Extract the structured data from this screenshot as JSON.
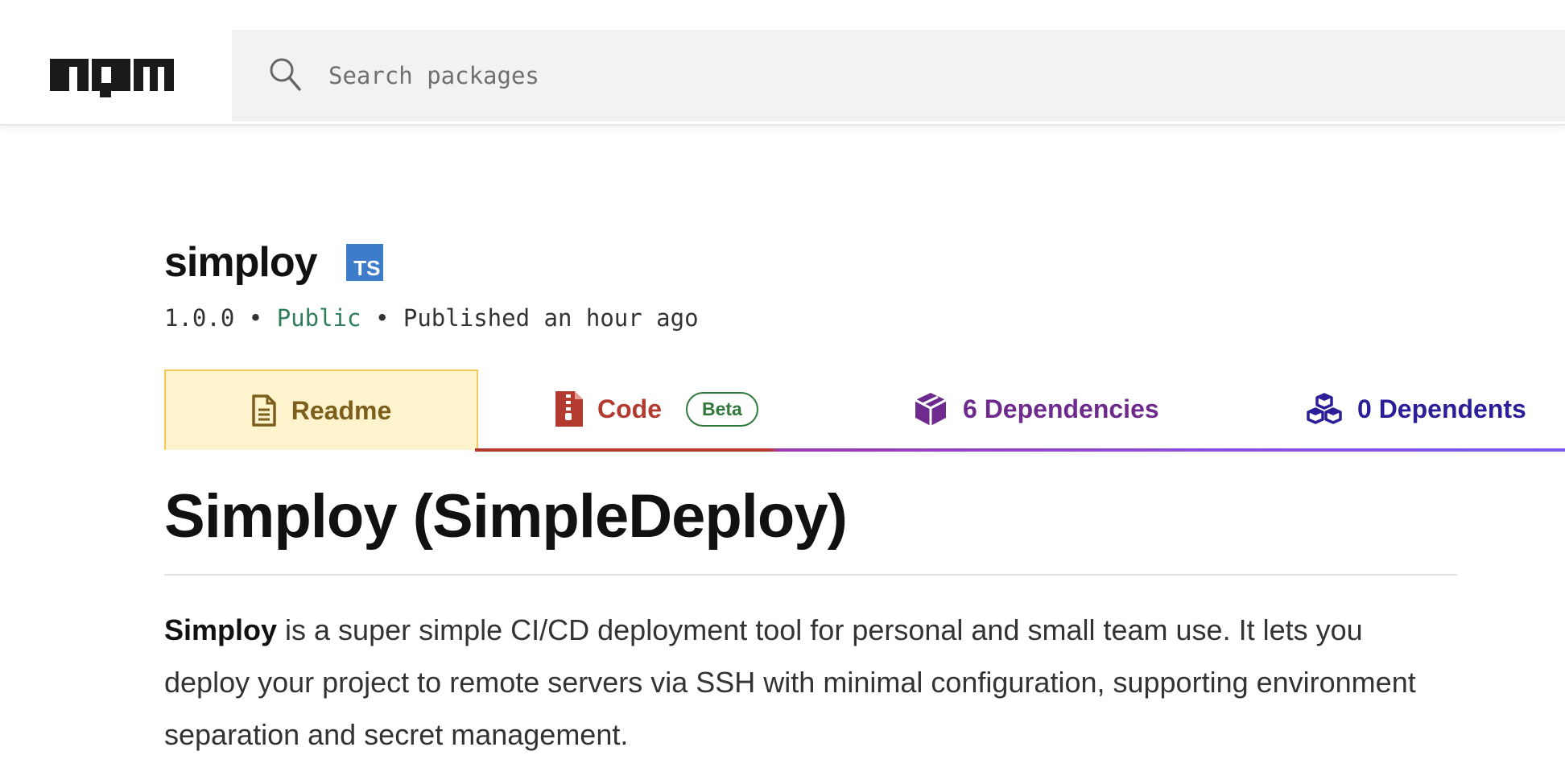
{
  "header": {
    "logo_text": "npm",
    "search_placeholder": "Search packages"
  },
  "package": {
    "name": "simploy",
    "ts_badge": "TS",
    "version": "1.0.0",
    "separator": "•",
    "visibility": "Public",
    "published": "Published an hour ago"
  },
  "tabs": {
    "readme": "Readme",
    "code": "Code",
    "code_badge": "Beta",
    "dependencies": "6 Dependencies",
    "dependents": "0 Dependents"
  },
  "readme": {
    "title": "Simploy (SimpleDeploy)",
    "intro_bold": "Simploy",
    "intro_rest": " is a super simple CI/CD deployment tool for personal and small team use. It lets you deploy your project to remote servers via SSH with minimal configuration, supporting environment separation and secret management."
  },
  "colors": {
    "readme_tab": "#7c5f1c",
    "code_tab": "#b23a2f",
    "dependencies_tab": "#6e2a8d",
    "dependents_tab": "#2c1e98",
    "public": "#2f7d5a"
  }
}
